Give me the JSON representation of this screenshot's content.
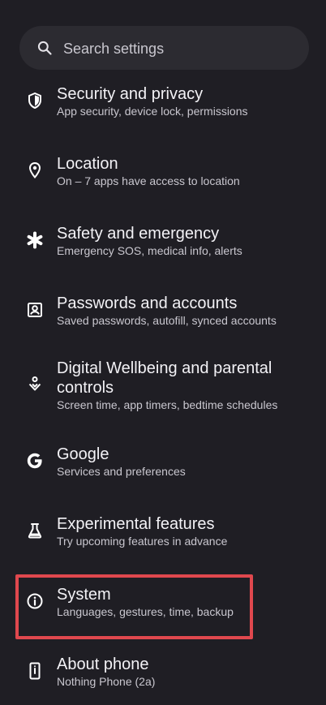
{
  "search": {
    "placeholder": "Search settings",
    "icon": "search-icon"
  },
  "items": [
    {
      "icon": "shield-icon",
      "title": "Security and privacy",
      "subtitle": "App security, device lock, permissions"
    },
    {
      "icon": "location-pin-icon",
      "title": "Location",
      "subtitle": "On – 7 apps have access to location"
    },
    {
      "icon": "asterisk-icon",
      "title": "Safety and emergency",
      "subtitle": "Emergency SOS, medical info, alerts"
    },
    {
      "icon": "account-box-icon",
      "title": "Passwords and accounts",
      "subtitle": "Saved passwords, autofill, synced accounts"
    },
    {
      "icon": "wellbeing-icon",
      "title": "Digital Wellbeing and parental controls",
      "subtitle": "Screen time, app timers, bedtime schedules"
    },
    {
      "icon": "google-icon",
      "title": "Google",
      "subtitle": "Services and preferences"
    },
    {
      "icon": "flask-icon",
      "title": "Experimental features",
      "subtitle": "Try upcoming features in advance"
    },
    {
      "icon": "info-icon",
      "title": "System",
      "subtitle": "Languages, gestures, time, backup"
    },
    {
      "icon": "phone-icon",
      "title": "About phone",
      "subtitle": "Nothing Phone (2a)"
    }
  ],
  "colors": {
    "background": "#1f1e24",
    "search_bg": "#2c2b31",
    "highlight": "#e0484e"
  }
}
